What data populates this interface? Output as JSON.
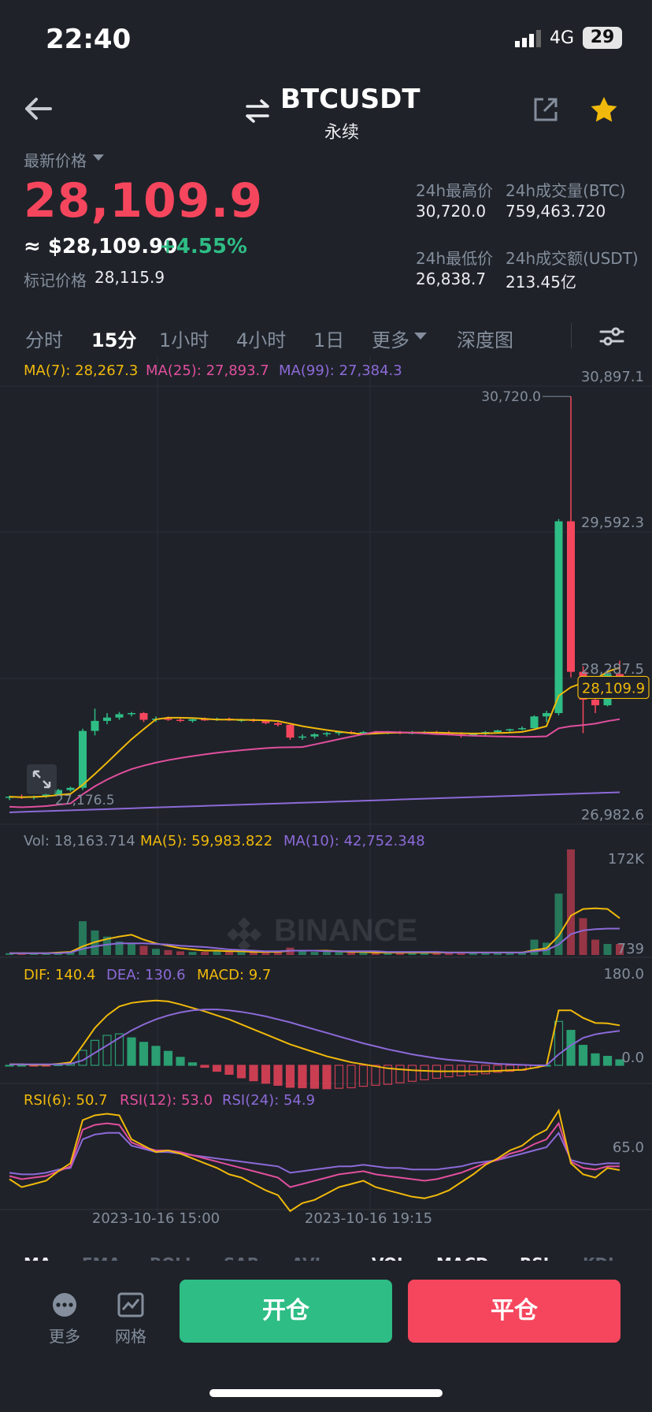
{
  "status_bar": {
    "time": "22:40",
    "network": "4G",
    "battery": "29"
  },
  "header": {
    "symbol": "BTCUSDT",
    "contract": "永续"
  },
  "price": {
    "label": "最新价格",
    "last": "28,109.9",
    "usd": "≈ $28,109.90",
    "change": "+4.55%",
    "mark_label": "标记价格",
    "mark_value": "28,115.9"
  },
  "stats": {
    "high_label": "24h最高价",
    "high": "30,720.0",
    "vol_btc_label": "24h成交量(BTC)",
    "vol_btc": "759,463.720",
    "low_label": "24h最低价",
    "low": "26,838.7",
    "vol_usdt_label": "24h成交额(USDT)",
    "vol_usdt": "213.45亿"
  },
  "tabs": [
    "分时",
    "15分",
    "1小时",
    "4小时",
    "1日",
    "更多",
    "深度图"
  ],
  "active_tab": "15分",
  "chart_labels": {
    "ma7": "MA(7): 28,267.3",
    "ma25": "MA(25): 27,893.7",
    "ma99": "MA(99): 27,384.3",
    "vol": "Vol: 18,163.714",
    "vol_ma5": "MA(5): 59,983.822",
    "vol_ma10": "MA(10): 42,752.348",
    "dif": "DIF: 140.4",
    "dea": "DEA: 130.6",
    "macd": "MACD: 9.7",
    "rsi6": "RSI(6): 50.7",
    "rsi12": "RSI(12): 53.0",
    "rsi24": "RSI(24): 54.9",
    "watermark": "BINANCE",
    "high_marker": "30,720.0",
    "low_marker": "27,176.5",
    "current_price_tag": "28,109.9",
    "date1": "2023-10-16 15:00",
    "date2": "2023-10-16 19:15"
  },
  "colors": {
    "up": "#2ebd85",
    "down": "#f6465d",
    "ma7": "#f0b90b",
    "ma25": "#e04f9e",
    "ma99": "#8c6ad8",
    "bg": "#1f2229",
    "grid": "#2b2f36"
  },
  "chart_data": {
    "type": "candlestick",
    "price_axis": [
      "30,897.1",
      "29,592.3",
      "28,287.5",
      "26,982.6"
    ],
    "price_range": [
      26982.6,
      30897.1
    ],
    "volume_axis": [
      "172K",
      "739"
    ],
    "macd_axis": [
      "180.0",
      "0.0"
    ],
    "rsi_axis": [
      "65.0"
    ],
    "candles": [
      {
        "o": 27120,
        "h": 27140,
        "l": 27100,
        "c": 27130
      },
      {
        "o": 27130,
        "h": 27150,
        "l": 27110,
        "c": 27120
      },
      {
        "o": 27120,
        "h": 27140,
        "l": 27105,
        "c": 27135
      },
      {
        "o": 27135,
        "h": 27160,
        "l": 27120,
        "c": 27150
      },
      {
        "o": 27150,
        "h": 27200,
        "l": 27140,
        "c": 27190
      },
      {
        "o": 27190,
        "h": 27220,
        "l": 27176,
        "c": 27210
      },
      {
        "o": 27210,
        "h": 27740,
        "l": 27190,
        "c": 27720
      },
      {
        "o": 27720,
        "h": 27920,
        "l": 27680,
        "c": 27810
      },
      {
        "o": 27810,
        "h": 27880,
        "l": 27780,
        "c": 27840
      },
      {
        "o": 27840,
        "h": 27890,
        "l": 27820,
        "c": 27870
      },
      {
        "o": 27870,
        "h": 27890,
        "l": 27850,
        "c": 27880
      },
      {
        "o": 27880,
        "h": 27890,
        "l": 27800,
        "c": 27820
      },
      {
        "o": 27820,
        "h": 27850,
        "l": 27800,
        "c": 27830
      },
      {
        "o": 27830,
        "h": 27850,
        "l": 27810,
        "c": 27820
      },
      {
        "o": 27820,
        "h": 27840,
        "l": 27800,
        "c": 27810
      },
      {
        "o": 27810,
        "h": 27830,
        "l": 27795,
        "c": 27825
      },
      {
        "o": 27825,
        "h": 27840,
        "l": 27810,
        "c": 27820
      },
      {
        "o": 27820,
        "h": 27840,
        "l": 27810,
        "c": 27830
      },
      {
        "o": 27830,
        "h": 27840,
        "l": 27810,
        "c": 27815
      },
      {
        "o": 27815,
        "h": 27830,
        "l": 27800,
        "c": 27820
      },
      {
        "o": 27820,
        "h": 27830,
        "l": 27800,
        "c": 27810
      },
      {
        "o": 27810,
        "h": 27820,
        "l": 27780,
        "c": 27790
      },
      {
        "o": 27790,
        "h": 27800,
        "l": 27760,
        "c": 27775
      },
      {
        "o": 27775,
        "h": 27790,
        "l": 27640,
        "c": 27660
      },
      {
        "o": 27660,
        "h": 27690,
        "l": 27640,
        "c": 27670
      },
      {
        "o": 27670,
        "h": 27700,
        "l": 27650,
        "c": 27690
      },
      {
        "o": 27690,
        "h": 27710,
        "l": 27670,
        "c": 27700
      },
      {
        "o": 27700,
        "h": 27720,
        "l": 27680,
        "c": 27710
      },
      {
        "o": 27710,
        "h": 27720,
        "l": 27690,
        "c": 27700
      },
      {
        "o": 27700,
        "h": 27720,
        "l": 27690,
        "c": 27710
      },
      {
        "o": 27710,
        "h": 27720,
        "l": 27690,
        "c": 27700
      },
      {
        "o": 27700,
        "h": 27720,
        "l": 27690,
        "c": 27710
      },
      {
        "o": 27710,
        "h": 27720,
        "l": 27690,
        "c": 27700
      },
      {
        "o": 27700,
        "h": 27720,
        "l": 27690,
        "c": 27705
      },
      {
        "o": 27705,
        "h": 27720,
        "l": 27690,
        "c": 27710
      },
      {
        "o": 27710,
        "h": 27720,
        "l": 27690,
        "c": 27700
      },
      {
        "o": 27700,
        "h": 27720,
        "l": 27680,
        "c": 27690
      },
      {
        "o": 27690,
        "h": 27710,
        "l": 27660,
        "c": 27680
      },
      {
        "o": 27680,
        "h": 27700,
        "l": 27670,
        "c": 27695
      },
      {
        "o": 27695,
        "h": 27720,
        "l": 27680,
        "c": 27710
      },
      {
        "o": 27710,
        "h": 27730,
        "l": 27700,
        "c": 27725
      },
      {
        "o": 27725,
        "h": 27740,
        "l": 27710,
        "c": 27735
      },
      {
        "o": 27735,
        "h": 27760,
        "l": 27725,
        "c": 27745
      },
      {
        "o": 27745,
        "h": 27860,
        "l": 27740,
        "c": 27850
      },
      {
        "o": 27850,
        "h": 27900,
        "l": 27800,
        "c": 27880
      },
      {
        "o": 27880,
        "h": 29620,
        "l": 27860,
        "c": 29600
      },
      {
        "o": 29600,
        "h": 30720,
        "l": 28200,
        "c": 28250
      },
      {
        "o": 28250,
        "h": 28300,
        "l": 27700,
        "c": 28000
      },
      {
        "o": 28000,
        "h": 28150,
        "l": 27880,
        "c": 27950
      },
      {
        "o": 27950,
        "h": 28240,
        "l": 27940,
        "c": 28230
      },
      {
        "o": 28230,
        "h": 28350,
        "l": 28100,
        "c": 28110
      }
    ],
    "volume": [
      3,
      3,
      2,
      3,
      4,
      6,
      55,
      40,
      30,
      22,
      18,
      15,
      10,
      8,
      6,
      5,
      5,
      6,
      5,
      5,
      5,
      5,
      6,
      12,
      6,
      5,
      5,
      5,
      4,
      4,
      4,
      4,
      4,
      4,
      4,
      4,
      4,
      5,
      4,
      4,
      4,
      5,
      5,
      25,
      20,
      100,
      172,
      60,
      25,
      18,
      18
    ],
    "vol_ma5": [
      3,
      3,
      3,
      3,
      4,
      5,
      14,
      21,
      26,
      30,
      33,
      25,
      19,
      15,
      11,
      9,
      7,
      7,
      6,
      6,
      5,
      5,
      5,
      7,
      7,
      7,
      7,
      6,
      5,
      5,
      4,
      4,
      4,
      4,
      4,
      4,
      4,
      4,
      4,
      4,
      4,
      4,
      4,
      8,
      11,
      31,
      64,
      75,
      76,
      75,
      60
    ],
    "vol_ma10": [
      3,
      3,
      3,
      3,
      3,
      4,
      10,
      14,
      17,
      19,
      19,
      19,
      18,
      17,
      15,
      14,
      13,
      11,
      9,
      8,
      7,
      6,
      6,
      7,
      7,
      7,
      6,
      6,
      6,
      6,
      6,
      5,
      5,
      5,
      5,
      5,
      4,
      4,
      4,
      4,
      4,
      4,
      4,
      6,
      8,
      17,
      34,
      40,
      42,
      43,
      43
    ],
    "dif": [
      2,
      2,
      1,
      1,
      3,
      6,
      40,
      75,
      100,
      118,
      125,
      128,
      130,
      128,
      122,
      115,
      108,
      100,
      92,
      82,
      72,
      62,
      52,
      42,
      34,
      26,
      18,
      12,
      6,
      2,
      -2,
      -6,
      -8,
      -10,
      -11,
      -12,
      -12,
      -12,
      -12,
      -12,
      -11,
      -10,
      -9,
      -5,
      0,
      110,
      110,
      95,
      85,
      84,
      80
    ],
    "dea": [
      2,
      2,
      2,
      2,
      2,
      3,
      10,
      25,
      40,
      55,
      70,
      82,
      92,
      100,
      106,
      110,
      112,
      112,
      110,
      107,
      103,
      98,
      92,
      86,
      79,
      72,
      65,
      58,
      51,
      44,
      38,
      32,
      27,
      22,
      18,
      14,
      11,
      9,
      7,
      5,
      3,
      2,
      1,
      0,
      0,
      22,
      40,
      55,
      62,
      66,
      69
    ],
    "macd": [
      0,
      0,
      -1,
      -1,
      1,
      3,
      30,
      50,
      60,
      63,
      55,
      46,
      38,
      28,
      16,
      5,
      -4,
      -12,
      -18,
      -25,
      -31,
      -36,
      -40,
      -44,
      -45,
      -46,
      -47,
      -46,
      -45,
      -42,
      -40,
      -38,
      -35,
      -32,
      -29,
      -26,
      -23,
      -21,
      -19,
      -17,
      -14,
      -12,
      -10,
      -5,
      0,
      88,
      70,
      40,
      23,
      18,
      11
    ],
    "rsi6": [
      45,
      40,
      42,
      44,
      50,
      55,
      82,
      85,
      86,
      85,
      70,
      66,
      62,
      63,
      61,
      58,
      55,
      52,
      48,
      46,
      42,
      38,
      35,
      25,
      30,
      32,
      36,
      40,
      42,
      44,
      40,
      38,
      36,
      34,
      33,
      35,
      38,
      43,
      48,
      54,
      58,
      63,
      66,
      72,
      76,
      88,
      55,
      48,
      46,
      52,
      50.7
    ],
    "rsi12": [
      47,
      45,
      46,
      47,
      50,
      53,
      76,
      79,
      80,
      79,
      68,
      65,
      63,
      63,
      62,
      60,
      58,
      56,
      54,
      52,
      50,
      48,
      46,
      40,
      42,
      44,
      46,
      48,
      49,
      50,
      48,
      47,
      46,
      45,
      44,
      45,
      47,
      49,
      52,
      55,
      57,
      61,
      63,
      67,
      70,
      80,
      56,
      52,
      51,
      53,
      53.0
    ],
    "rsi24": [
      49,
      48,
      48,
      49,
      51,
      52,
      70,
      73,
      74,
      74,
      66,
      64,
      62,
      62,
      61,
      60,
      59,
      58,
      57,
      56,
      55,
      54,
      53,
      49,
      50,
      51,
      52,
      53,
      53,
      54,
      53,
      52,
      52,
      51,
      51,
      51,
      52,
      53,
      55,
      56,
      57,
      59,
      61,
      63,
      65,
      74,
      57,
      55,
      54,
      55,
      54.9
    ]
  },
  "indicator_tabs": [
    "MA",
    "EMA",
    "BOLL",
    "SAR",
    "AVL",
    "VOL",
    "MACD",
    "RSI",
    "KDJ"
  ],
  "bottom": {
    "more": "更多",
    "grid": "网格",
    "open": "开仓",
    "close": "平仓"
  }
}
